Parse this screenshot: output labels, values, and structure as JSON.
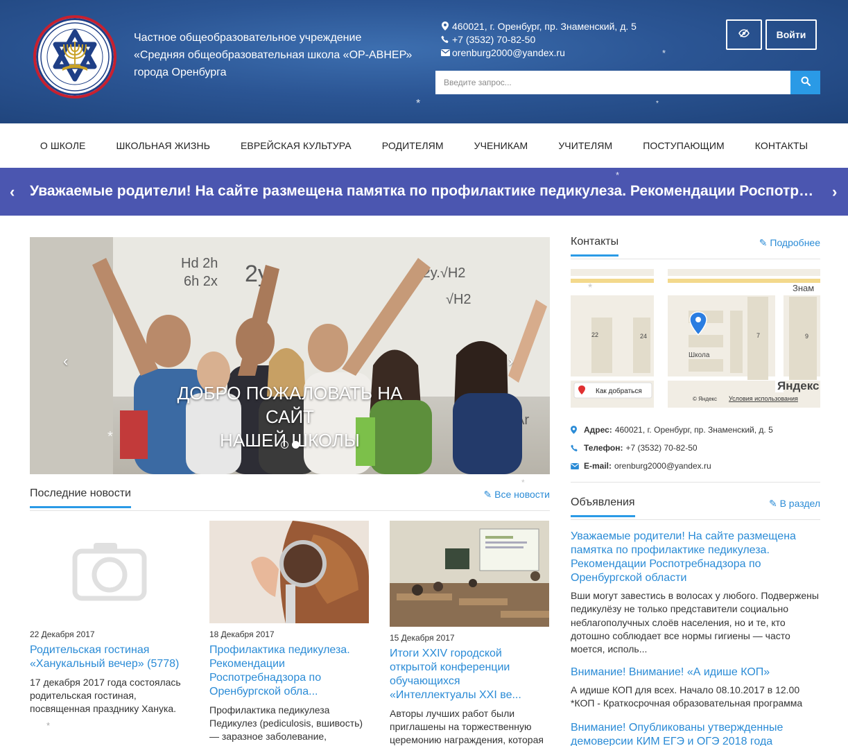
{
  "header": {
    "school_name": [
      "Частное общеобразовательное учреждение",
      "«Средняя общеобразовательная школа «ОР-АВНЕР»",
      "города Оренбурга"
    ],
    "logo_text": "«ОР-АВНЕР» г. ОРЕНБУРГ",
    "address": "460021, г. Оренбург, пр. Знаменский, д. 5",
    "phone": "+7 (3532) 70-82-50",
    "email": "orenburg2000@yandex.ru",
    "login_label": "Войти",
    "search_placeholder": "Введите запрос...",
    "icons": {
      "accessibility": "eye-slash-icon",
      "search": "search-icon"
    }
  },
  "nav": {
    "items": [
      "О ШКОЛЕ",
      "ШКОЛЬНАЯ ЖИЗНЬ",
      "ЕВРЕЙСКАЯ КУЛЬТУРА",
      "РОДИТЕЛЯМ",
      "УЧЕНИКАМ",
      "УЧИТЕЛЯМ",
      "ПОСТУПАЮЩИМ",
      "КОНТАКТЫ"
    ]
  },
  "ticker": {
    "text": "Уважаемые родители! На сайте размещена памятка по профилактике педикулеза. Рекомендации Роспотребнадзора по Оренбургской области",
    "prev": "‹",
    "next": "›"
  },
  "slider": {
    "caption_line1": "ДОБРО ПОЖАЛОВАТЬ НА САЙТ",
    "caption_line2": "НАШЕЙ ШКОЛЫ",
    "prev": "‹",
    "next": "›",
    "board_text": [
      "Hd 2h",
      "6h 2x",
      "2y",
      "-2y.√H2",
      "√H2",
      "Ar"
    ]
  },
  "news": {
    "title": "Последние новости",
    "all_link": "Все новости",
    "items": [
      {
        "date": "22 Декабря 2017",
        "title": "Родительская гостиная «Ханукальный вечер» (5778)",
        "text": "17 декабря 2017 года состоялась родительская гостиная, посвященная празднику Ханука."
      },
      {
        "date": "18 Декабря 2017",
        "title": "Профилактика педикулеза. Рекомендации Роспотребнадзора по Оренбургской обла...",
        "text": "Профилактика педикулеза Педикулез (pediculosis, вшивость) — заразное заболевание,"
      },
      {
        "date": "15 Декабря 2017",
        "title": "Итоги XXIV городской открытой конференции обучающихся «Интеллектуалы XXI ве...",
        "text": "Авторы лучших работ были приглашены на торжественную церемонию награждения, которая"
      }
    ]
  },
  "contacts": {
    "title": "Контакты",
    "more_link": "Подробнее",
    "map": {
      "labels": [
        "Знам",
        "22",
        "24",
        "7",
        "9",
        "Школа",
        "Как добраться",
        "Яндекс",
        "© Яндекс",
        "Условия использования"
      ]
    },
    "address_label": "Адрес:",
    "address": "460021, г. Оренбург, пр. Знаменский, д. 5",
    "phone_label": "Телефон:",
    "phone": "+7 (3532) 70-82-50",
    "email_label": "E-mail:",
    "email": "orenburg2000@yandex.ru"
  },
  "announcements": {
    "title": "Объявления",
    "more_link": "В раздел",
    "items": [
      {
        "title": "Уважаемые родители! На сайте размещена памятка по профилактике педикулеза. Рекомендации Роспотребнадзора по Оренбургской области",
        "text": "Вши могут завестись в волосах у любого. Подвержены педикулёзу не только представители социально неблагополучных слоёв населения, но и те, кто дотошно соблюдает все нормы гигиены — часто моется, исполь..."
      },
      {
        "title": "Внимание! Внимание! «А идише КОП»",
        "text": "А идише КОП для всех. Начало 08.10.2017 в 12.00 *КОП - Краткосрочная образовательная программа"
      },
      {
        "title": "Внимание! Опубликованы утвержденные демоверсии КИМ ЕГЭ и ОГЭ 2018 года",
        "text": ""
      }
    ]
  },
  "colors": {
    "header_bg": "#2b5594",
    "ticker_bg": "#4b56b0",
    "accent": "#2a9ae6",
    "link": "#2a8bd6"
  }
}
